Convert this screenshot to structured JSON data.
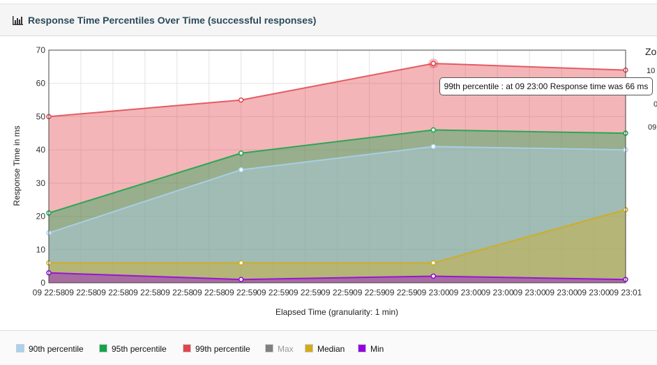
{
  "panel": {
    "title": "Response Time Percentiles Over Time (successful responses)",
    "icon": "bar-chart-icon"
  },
  "zoom": {
    "label": "Zo",
    "value1": "10",
    "value2": "0",
    "value3": "09"
  },
  "tooltip": {
    "text": "99th percentile : at 09 23:00 Response time was 66 ms"
  },
  "chart_data": {
    "type": "area",
    "xlabel": "Elapsed Time (granularity: 1 min)",
    "ylabel": "Response Time in ms",
    "ylim": [
      0,
      70
    ],
    "yticks": [
      0,
      10,
      20,
      30,
      40,
      50,
      60,
      70
    ],
    "x": [
      "09 22:58",
      "09 22:59",
      "09 23:00",
      "09 23:01"
    ],
    "xtick_labels": [
      "09 22:58",
      "09 22:58",
      "09 22:58",
      "09 22:58",
      "09 22:58",
      "09 22:58",
      "09 22:59",
      "09 22:59",
      "09 22:59",
      "09 22:59",
      "09 22:59",
      "09 22:59",
      "09 23:00",
      "09 23:00",
      "09 23:00",
      "09 23:00",
      "09 23:00",
      "09 23:00",
      "09 23:01"
    ],
    "grid": true,
    "legend_position": "bottom",
    "series": [
      {
        "name": "99th percentile",
        "color": "#e0454e",
        "values": [
          50,
          55,
          66,
          64
        ],
        "visible": true
      },
      {
        "name": "95th percentile",
        "color": "#11a54a",
        "values": [
          21,
          39,
          46,
          45
        ],
        "visible": true
      },
      {
        "name": "90th percentile",
        "color": "#a9d2f0",
        "values": [
          15,
          34,
          41,
          40
        ],
        "visible": true
      },
      {
        "name": "Max",
        "color": "#808080",
        "values": [],
        "visible": false
      },
      {
        "name": "Median",
        "color": "#d2ab19",
        "values": [
          6,
          6,
          6,
          22
        ],
        "visible": true
      },
      {
        "name": "Min",
        "color": "#9400e0",
        "values": [
          3,
          1,
          2,
          1
        ],
        "visible": true
      }
    ],
    "highlight": {
      "series": "99th percentile",
      "index": 2
    }
  },
  "legend": [
    {
      "label": "90th percentile",
      "color": "#a9d2f0",
      "enabled": true
    },
    {
      "label": "95th percentile",
      "color": "#11a54a",
      "enabled": true
    },
    {
      "label": "99th percentile",
      "color": "#e0454e",
      "enabled": true
    },
    {
      "label": "Max",
      "color": "#808080",
      "enabled": false
    },
    {
      "label": "Median",
      "color": "#d2ab19",
      "enabled": true
    },
    {
      "label": "Min",
      "color": "#9400e0",
      "enabled": true
    }
  ]
}
